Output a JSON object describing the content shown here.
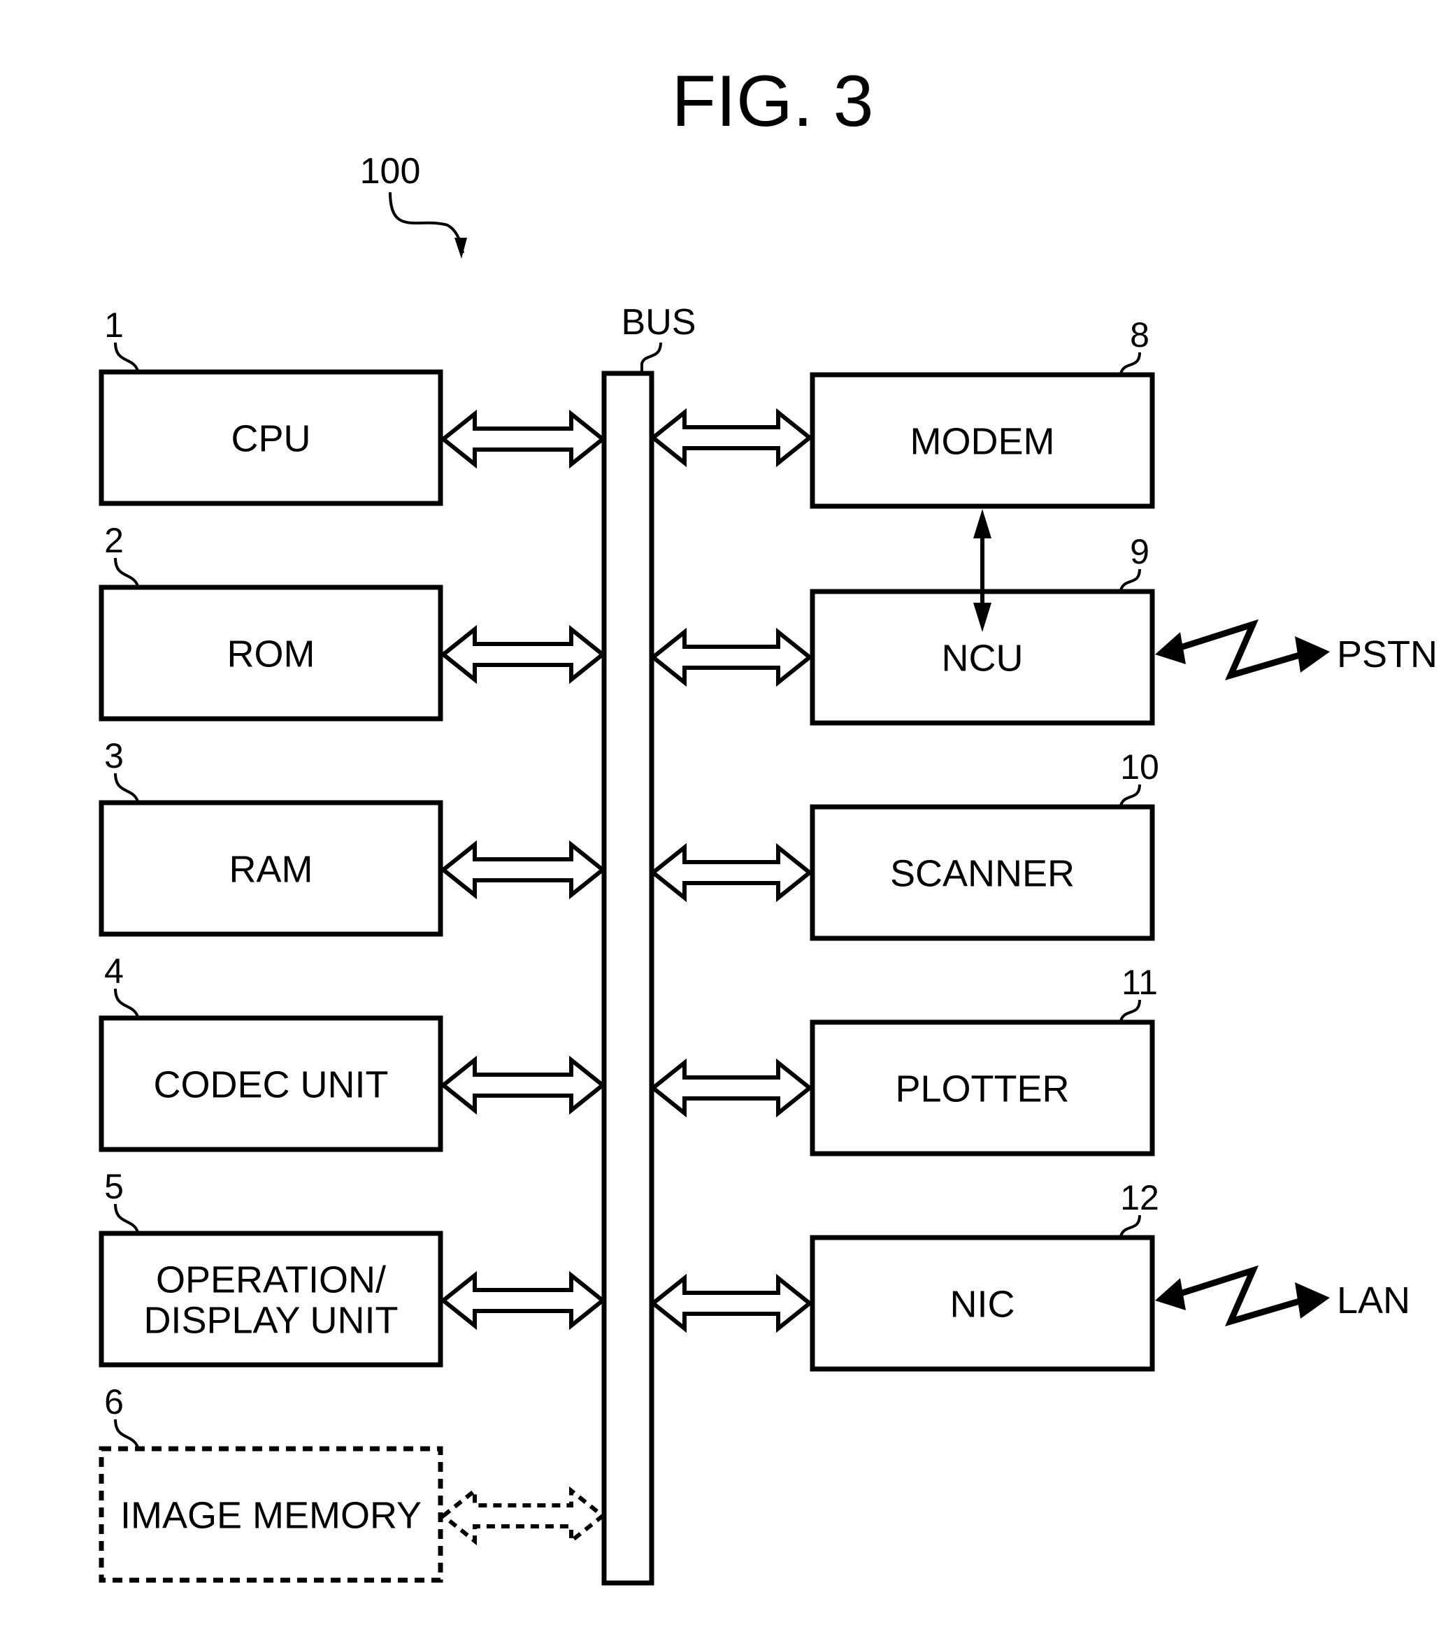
{
  "figure": {
    "title": "FIG. 3",
    "system_ref": "100",
    "bus_label": "BUS"
  },
  "left_blocks": [
    {
      "ref": "1",
      "lines": [
        "CPU"
      ],
      "dashed": false
    },
    {
      "ref": "2",
      "lines": [
        "ROM"
      ],
      "dashed": false
    },
    {
      "ref": "3",
      "lines": [
        "RAM"
      ],
      "dashed": false
    },
    {
      "ref": "4",
      "lines": [
        "CODEC UNIT"
      ],
      "dashed": false
    },
    {
      "ref": "5",
      "lines": [
        "OPERATION/",
        "DISPLAY UNIT"
      ],
      "dashed": false
    },
    {
      "ref": "6",
      "lines": [
        "IMAGE MEMORY"
      ],
      "dashed": true
    }
  ],
  "right_blocks": [
    {
      "ref": "8",
      "lines": [
        "MODEM"
      ]
    },
    {
      "ref": "9",
      "lines": [
        "NCU"
      ],
      "external": "PSTN"
    },
    {
      "ref": "10",
      "lines": [
        "SCANNER"
      ]
    },
    {
      "ref": "11",
      "lines": [
        "PLOTTER"
      ]
    },
    {
      "ref": "12",
      "lines": [
        "NIC"
      ],
      "external": "LAN"
    }
  ],
  "links": [
    {
      "from": "MODEM",
      "to": "NCU",
      "type": "bidirectional"
    }
  ]
}
